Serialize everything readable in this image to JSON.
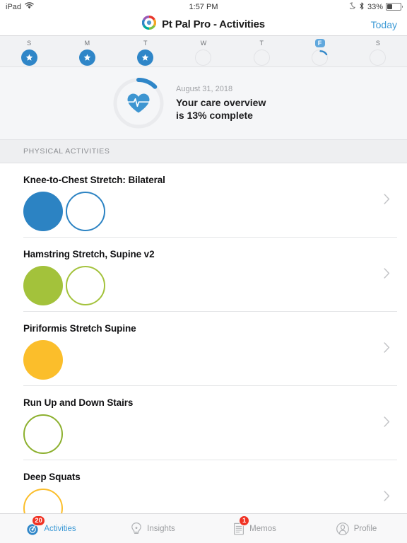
{
  "status_bar": {
    "device": "iPad",
    "wifi_icon": "wifi-icon",
    "time": "1:57 PM",
    "dnd_icon": "moon-icon",
    "bluetooth_icon": "bluetooth-icon",
    "battery_percent": "33%"
  },
  "nav": {
    "logo_icon": "app-logo-icon",
    "title": "Pt Pal Pro - Activities",
    "today_label": "Today"
  },
  "week": {
    "days": [
      {
        "letter": "S",
        "state": "completed",
        "is_today": false,
        "icon": "star-icon"
      },
      {
        "letter": "M",
        "state": "completed",
        "is_today": false,
        "icon": "star-icon"
      },
      {
        "letter": "T",
        "state": "completed",
        "is_today": false,
        "icon": "star-icon"
      },
      {
        "letter": "W",
        "state": "empty",
        "is_today": false,
        "icon": ""
      },
      {
        "letter": "T",
        "state": "empty",
        "is_today": false,
        "icon": ""
      },
      {
        "letter": "F",
        "state": "partial",
        "is_today": true,
        "icon": "",
        "progress_percent": 13
      },
      {
        "letter": "S",
        "state": "empty",
        "is_today": false,
        "icon": ""
      }
    ]
  },
  "overview": {
    "icon": "heart-pulse-icon",
    "date": "August 31, 2018",
    "line1": "Your care overview",
    "line2": "is 13% complete",
    "progress_percent": 13,
    "ring_color": "#2f86c8",
    "ring_track_color": "#eaebee"
  },
  "section": {
    "header": "PHYSICAL ACTIVITIES"
  },
  "activities": [
    {
      "title": "Knee-to-Chest Stretch: Bilateral",
      "color": "#2c83c3",
      "dots": [
        "filled",
        "outline"
      ],
      "chevron_icon": "chevron-right-icon"
    },
    {
      "title": "Hamstring Stretch, Supine v2",
      "color": "#a3c23b",
      "dots": [
        "filled",
        "outline"
      ],
      "chevron_icon": "chevron-right-icon"
    },
    {
      "title": "Piriformis Stretch Supine",
      "color": "#fbbe2b",
      "dots": [
        "filled"
      ],
      "chevron_icon": "chevron-right-icon"
    },
    {
      "title": "Run Up and Down Stairs",
      "color": "#8cb02e",
      "dots": [
        "outline"
      ],
      "chevron_icon": "chevron-right-icon"
    },
    {
      "title": "Deep Squats",
      "color": "#fbbe2b",
      "dots": [
        "outline"
      ],
      "chevron_icon": "chevron-right-icon"
    }
  ],
  "tabs": [
    {
      "label": "Activities",
      "icon": "activities-target-icon",
      "badge": "20",
      "active": true
    },
    {
      "label": "Insights",
      "icon": "lightbulb-icon",
      "badge": "",
      "active": false
    },
    {
      "label": "Memos",
      "icon": "document-icon",
      "badge": "1",
      "active": false
    },
    {
      "label": "Profile",
      "icon": "person-circle-icon",
      "badge": "",
      "active": false
    }
  ],
  "colors": {
    "accent": "#3d9ad6",
    "badge": "#f03224",
    "blue": "#2c83c3",
    "green": "#a3c23b",
    "yellow": "#fbbe2b"
  }
}
